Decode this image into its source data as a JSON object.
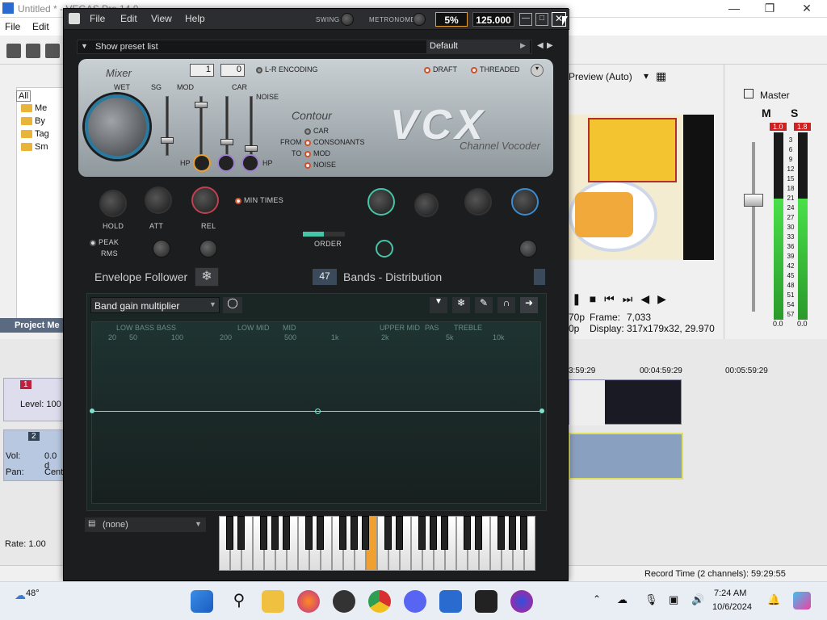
{
  "vegas": {
    "title": "Untitled * - VEGAS Pro 14.0",
    "menu": [
      "File",
      "Edit"
    ],
    "tree": [
      "All",
      "Me",
      "By",
      "Tag",
      "Sm"
    ],
    "project_media_label": "Project Me",
    "preview_label": "Preview (Auto)",
    "master_label": "Master",
    "mixer_buttons": [
      "M",
      "S"
    ],
    "meter_peaks": [
      "1.0",
      "1.8"
    ],
    "meter_scale": [
      "3",
      "6",
      "9",
      "12",
      "15",
      "18",
      "21",
      "24",
      "27",
      "30",
      "33",
      "36",
      "39",
      "42",
      "45",
      "48",
      "51",
      "54",
      "57"
    ],
    "meter_bottom": [
      "0.0",
      "0.0"
    ],
    "frame_label": "Frame:",
    "frame_value": "7,033",
    "display_label": "Display:",
    "display_value": "317x179x32, 29.970",
    "frame_prefix": "70p",
    "display_prefix": "0p",
    "timecodes": [
      "3:59:29",
      "00:04:59:29",
      "00:05:59:29"
    ],
    "track1_num": "1",
    "track1_level": "Level: 100",
    "track2_num": "2",
    "track2_vol_label": "Vol:",
    "track2_vol": "0.0 d",
    "track2_pan_label": "Pan:",
    "track2_pan": "Cent",
    "rate": "Rate: 1.00",
    "record_time": "Record Time (2 channels): 59:29:55"
  },
  "vcx": {
    "menu": [
      "File",
      "Edit",
      "View",
      "Help"
    ],
    "swing_label": "SWING",
    "metronome_label": "METRONOME",
    "percent": "5%",
    "tempo": "125.000",
    "show_preset": "Show preset list",
    "preset": "Default",
    "mixer_title": "Mixer",
    "wet": "WET",
    "sg": "SG",
    "mod": "MOD",
    "car": "CAR",
    "noise": "NOISE",
    "hp": "HP",
    "num1": "1",
    "num2": "0",
    "lr": "L-R ENCODING",
    "draft": "DRAFT",
    "threaded": "THREADED",
    "logo": "VCX",
    "subtitle": "Channel Vocoder",
    "contour": "Contour",
    "contour_opts": [
      "CAR",
      "CONSONANTS",
      "MOD",
      "NOISE"
    ],
    "from": "FROM",
    "to": "TO",
    "hold": "HOLD",
    "att": "ATT",
    "rel": "REL",
    "min_times": "MIN TIMES",
    "peak": "PEAK",
    "rms": "RMS",
    "order": "ORDER",
    "env_follower": "Envelope Follower",
    "bands_num": "47",
    "bands_label": "Bands - Distribution",
    "band_gain": "Band gain multiplier",
    "freq_top": [
      "LOW BASS",
      "BASS",
      "LOW MID",
      "MID",
      "UPPER MID",
      "PAS",
      "TREBLE"
    ],
    "freq_bottom": [
      "20",
      "50",
      "100",
      "200",
      "500",
      "1k",
      "2k",
      "5k",
      "10k"
    ],
    "keyboard_preset": "(none)"
  },
  "taskbar": {
    "temp": "48°",
    "time": "7:24 AM",
    "date": "10/6/2024"
  },
  "colors": {
    "accent": "#45c4a8",
    "led": "#d0502a",
    "key_highlight": "#f0a030"
  }
}
